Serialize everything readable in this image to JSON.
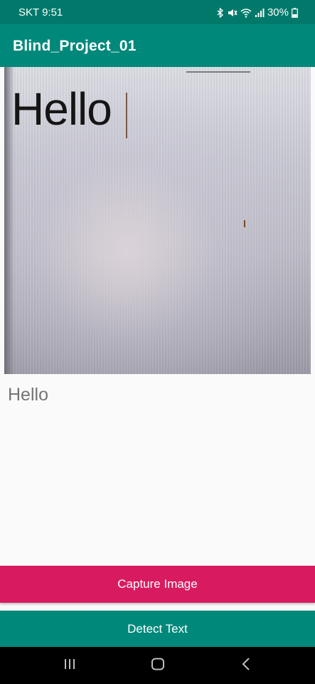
{
  "status_bar": {
    "carrier_time": "SKT 9:51",
    "battery": "30%",
    "icons": [
      "bluetooth-icon",
      "mute-icon",
      "wifi-icon",
      "signal-icon",
      "battery-icon"
    ]
  },
  "app_bar": {
    "title": "Blind_Project_01"
  },
  "camera_preview": {
    "captured_text": "Hello"
  },
  "result": {
    "text": "Hello"
  },
  "buttons": {
    "capture_label": "Capture Image",
    "detect_label": "Detect Text"
  },
  "colors": {
    "primary": "#00897b",
    "primary_dark": "#00796b",
    "accent": "#d81b60"
  },
  "nav_bar": {
    "icons": [
      "recent-apps-icon",
      "home-icon",
      "back-icon"
    ]
  }
}
